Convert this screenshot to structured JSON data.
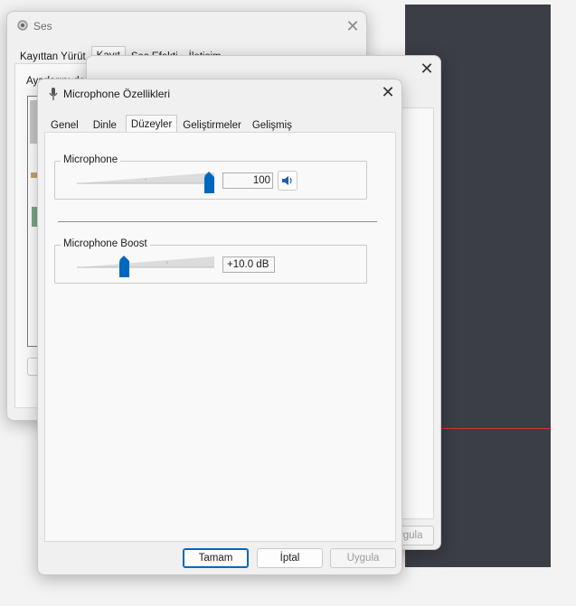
{
  "ses_window": {
    "title": "Ses",
    "tabs": [
      "Kayıttan Yürüt",
      "Kayıt",
      "Ses Efekti",
      "İletişim"
    ],
    "instruction": "Ayarlarını değiştirmek için kayıt yapma aygıtını aşağıdan seçin:"
  },
  "middle_window": {
    "apply_partial": "ygula"
  },
  "mic_window": {
    "title": "Microphone Özellikleri",
    "tabs": [
      "Genel",
      "Dinle",
      "Düzeyler",
      "Geliştirmeler",
      "Gelişmiş"
    ],
    "active_tab": 2,
    "microphone": {
      "label": "Microphone",
      "value": "100",
      "level": 1.0
    },
    "boost": {
      "label": "Microphone Boost",
      "value": "+10.0 dB",
      "level": 0.33
    },
    "buttons": {
      "ok": "Tamam",
      "cancel": "İptal",
      "apply": "Uygula"
    }
  },
  "colors": {
    "accent": "#0067c0",
    "dark_bg": "#3b3e45"
  }
}
